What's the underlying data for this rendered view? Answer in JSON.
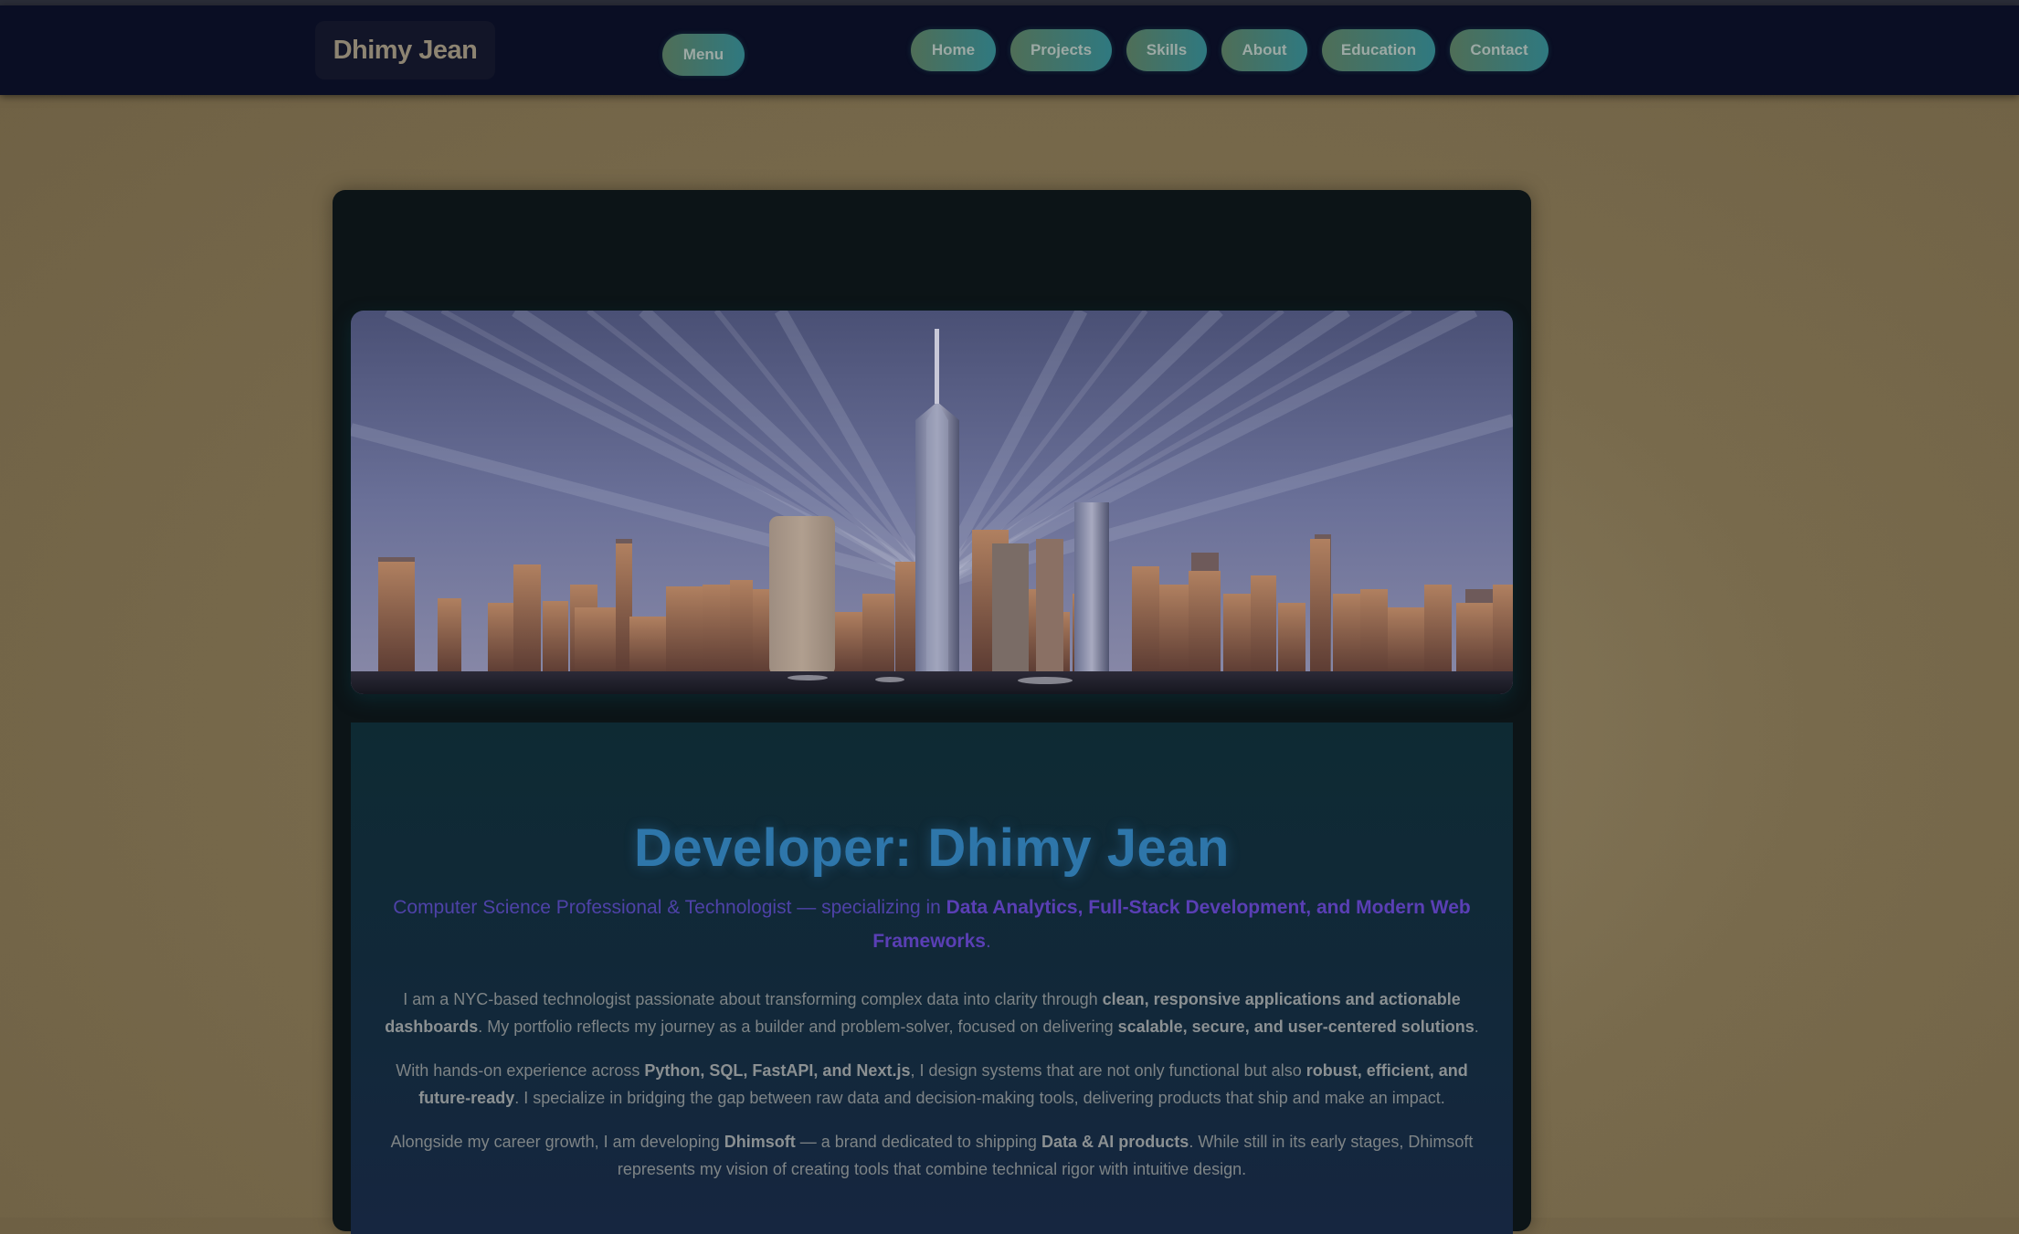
{
  "header": {
    "brand": "Dhimy Jean",
    "menu_label": "Menu",
    "nav": [
      "Home",
      "Projects",
      "Skills",
      "About",
      "Education",
      "Contact"
    ]
  },
  "hero": {
    "image_semantic": "city-skyline-image"
  },
  "main": {
    "title": "Developer: Dhimy Jean",
    "subtitle_pre": "Computer Science Professional & Technologist — specializing in ",
    "subtitle_bold": "Data Analytics, Full-Stack Development, and Modern Web Frameworks",
    "subtitle_post": ".",
    "p1": {
      "t1": "I am a NYC-based technologist passionate about transforming complex data into clarity through ",
      "b1": "clean, responsive applications and actionable dashboards",
      "t2": ". My portfolio reflects my journey as a builder and problem-solver, focused on delivering ",
      "b2": "scalable, secure, and user-centered solutions",
      "t3": "."
    },
    "p2": {
      "t1": "With hands-on experience across ",
      "b1": "Python, SQL, FastAPI, and Next.js",
      "t2": ", I design systems that are not only functional but also ",
      "b2": "robust, efficient, and future-ready",
      "t3": ". I specialize in bridging the gap between raw data and decision-making tools, delivering products that ship and make an impact."
    },
    "p3": {
      "t1": "Alongside my career growth, I am developing ",
      "b1": "Dhimsoft",
      "t2": " — a brand dedicated to shipping ",
      "b2": "Data & AI products",
      "t3": ". While still in its early stages, Dhimsoft represents my vision of creating tools that combine technical rigor with intuitive design."
    }
  },
  "colors": {
    "header_bg": "#0a0e24",
    "page_bg": "#786a4c",
    "card_bg": "#0c1417",
    "title": "#2e76aa",
    "subtitle": "#4e42a8",
    "pill_start": "#4f6e57",
    "pill_end": "#2f7980"
  }
}
